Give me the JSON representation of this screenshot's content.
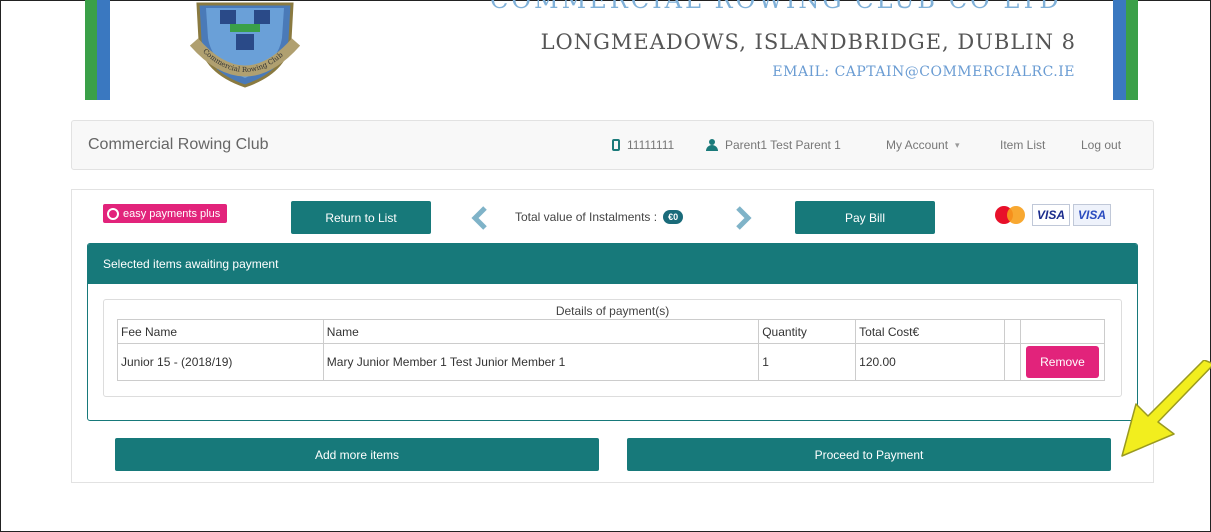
{
  "header": {
    "club_title": "COMMERCIAL ROWING CLUB CO LTD",
    "address": "LONGMEADOWS, ISLANDBRIDGE, DUBLIN 8",
    "email": "EMAIL: CAPTAIN@COMMERCIALRC.IE",
    "crest_text": "Commercial Rowing Club"
  },
  "navbar": {
    "brand": "Commercial Rowing Club",
    "phone": "11111111",
    "user": "Parent1 Test Parent 1",
    "my_account": "My Account",
    "item_list": "Item List",
    "log_out": "Log out"
  },
  "toolbar": {
    "easy_payments": "easy payments plus",
    "return_label": "Return to List",
    "total_label": "Total value of Instalments :",
    "total_value": "€0",
    "pay_bill_label": "Pay Bill",
    "card_visa_1": "VISA",
    "card_visa_2": "VISA"
  },
  "selected": {
    "header": "Selected items awaiting payment",
    "caption": "Details of payment(s)",
    "columns": [
      "Fee Name",
      "Name",
      "Quantity",
      "Total Cost€"
    ],
    "rows": [
      {
        "fee_name": "Junior 15 - (2018/19)",
        "name": "Mary Junior Member 1 Test Junior Member 1",
        "quantity": "1",
        "total_cost": "120.00",
        "action": "Remove"
      }
    ]
  },
  "actions": {
    "add_more": "Add more items",
    "proceed": "Proceed to Payment"
  },
  "colors": {
    "teal": "#17797a",
    "pink": "#e2237b",
    "annotation_arrow": "#f2ee1e"
  },
  "icons": [
    "phone-icon",
    "user-icon",
    "prev-arrow-icon",
    "next-arrow-icon",
    "mastercard-icon",
    "visa-icon",
    "annotation-arrow-icon"
  ]
}
